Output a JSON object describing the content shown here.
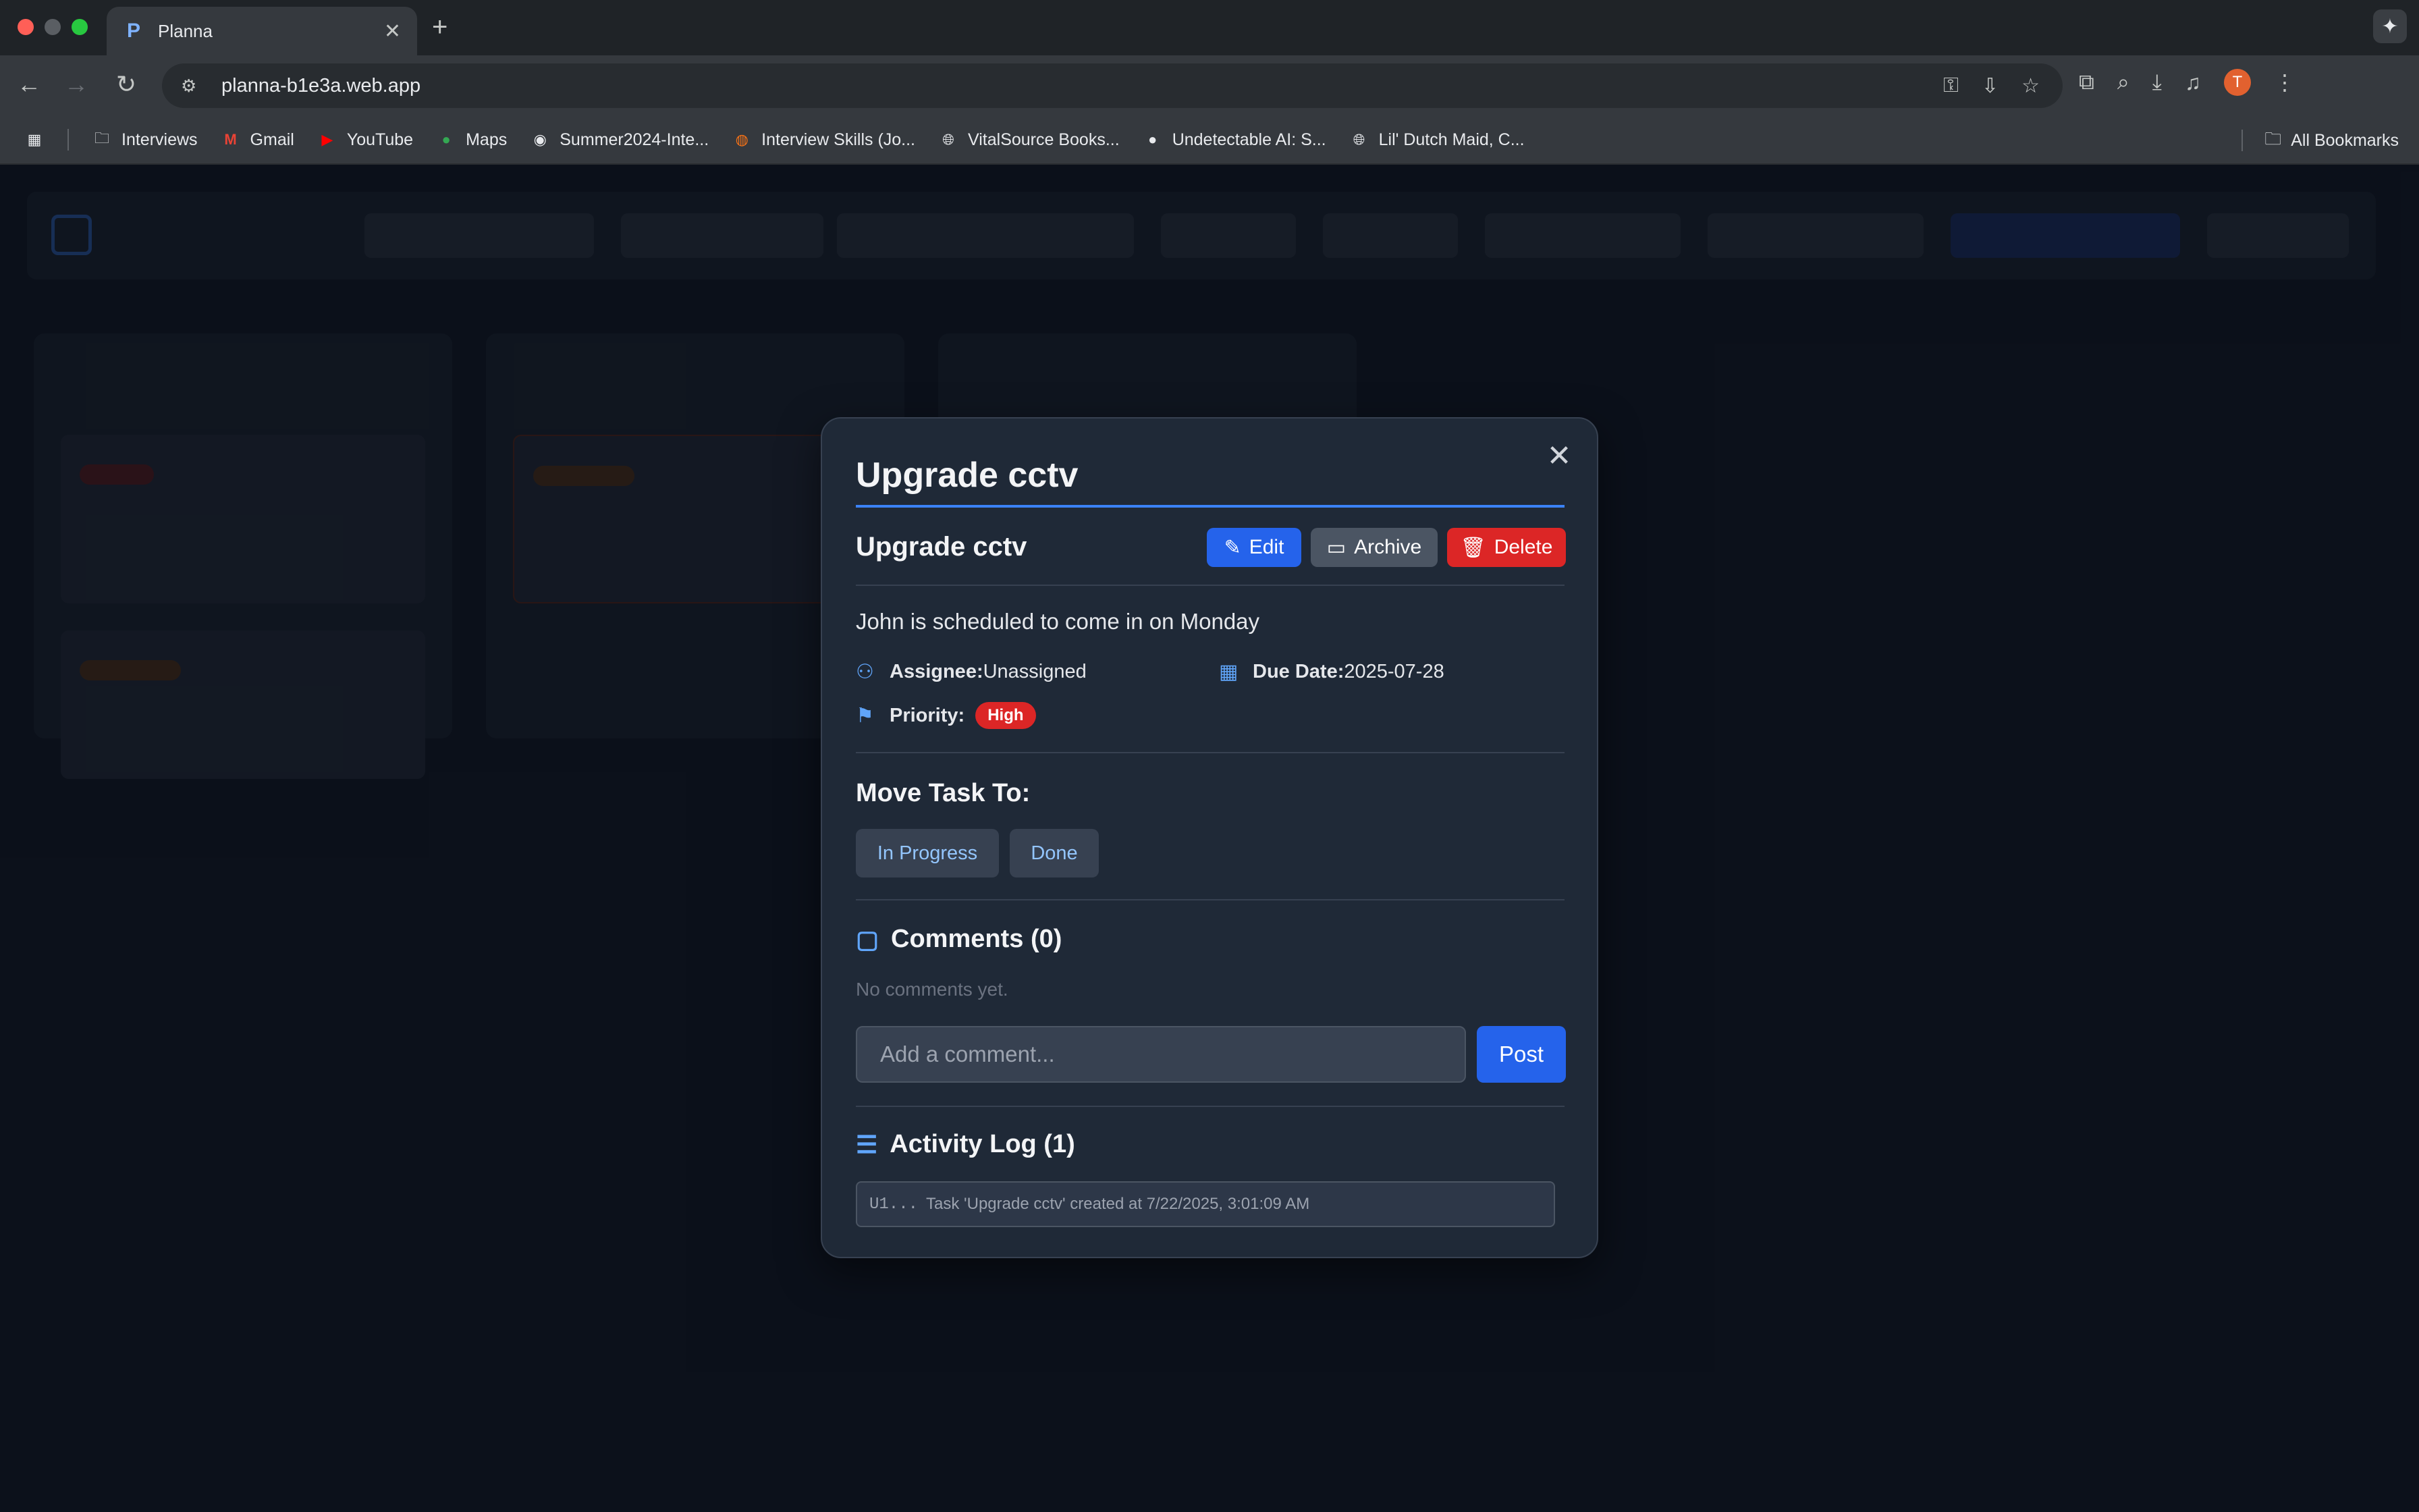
{
  "browser": {
    "tab_title": "Planna",
    "tab_favicon": "P",
    "url": "planna-b1e3a.web.app",
    "avatar_letter": "T",
    "bookmarks": [
      {
        "label": "Interviews",
        "icon": "folder-icon"
      },
      {
        "label": "Gmail",
        "icon": "gmail-icon"
      },
      {
        "label": "YouTube",
        "icon": "youtube-icon"
      },
      {
        "label": "Maps",
        "icon": "maps-icon"
      },
      {
        "label": "Summer2024-Inte...",
        "icon": "github-icon"
      },
      {
        "label": "Interview Skills (Jo...",
        "icon": "site-icon"
      },
      {
        "label": "VitalSource Books...",
        "icon": "globe-icon"
      },
      {
        "label": "Undetectable AI: S...",
        "icon": "site-icon"
      },
      {
        "label": "Lil' Dutch Maid, C...",
        "icon": "globe-icon"
      }
    ],
    "all_bookmarks": "All Bookmarks"
  },
  "modal": {
    "title": "Upgrade cctv",
    "task_name": "Upgrade cctv",
    "edit_label": "Edit",
    "archive_label": "Archive",
    "delete_label": "Delete",
    "description": "John is scheduled to come in on Monday",
    "assignee_label": "Assignee:",
    "assignee_value": "Unassigned",
    "due_label": "Due Date:",
    "due_value": "2025-07-28",
    "priority_label": "Priority:",
    "priority_value": "High",
    "move_title": "Move Task To:",
    "move_options": [
      "In Progress",
      "Done"
    ],
    "comments_title": "Comments (0)",
    "no_comments": "No comments yet.",
    "comment_placeholder": "Add a comment...",
    "post_label": "Post",
    "activity_title": "Activity Log (1)",
    "activity": [
      {
        "user": "U1...",
        "text": "Task 'Upgrade cctv' created at 7/22/2025, 3:01:09 AM"
      }
    ]
  },
  "colors": {
    "accent": "#2563eb",
    "danger": "#dc2626",
    "modal_bg": "#1f2937",
    "page_bg": "#111827"
  }
}
